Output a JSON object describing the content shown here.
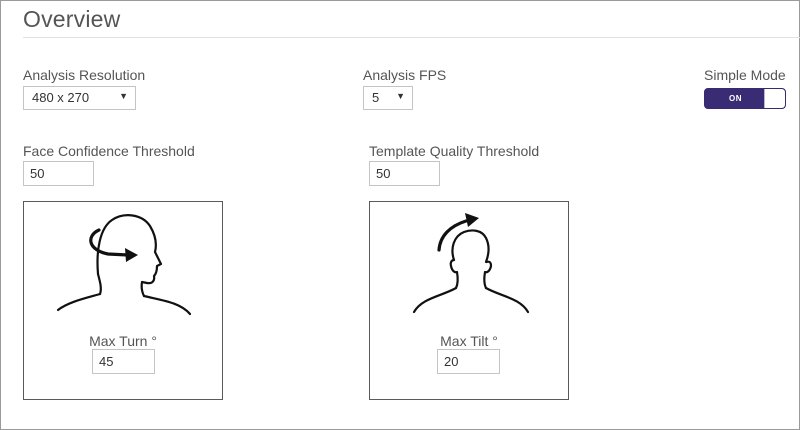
{
  "page": {
    "title": "Overview"
  },
  "analysis_resolution": {
    "label": "Analysis Resolution",
    "selected": "480 x 270",
    "caret_icon": "caret-down-icon"
  },
  "analysis_fps": {
    "label": "Analysis FPS",
    "selected": "5",
    "caret_icon": "caret-down-icon"
  },
  "simple_mode": {
    "label": "Simple Mode",
    "state_text": "ON",
    "on": true,
    "color": "#3a2c74"
  },
  "face_confidence": {
    "label": "Face Confidence Threshold",
    "value": "50"
  },
  "template_quality": {
    "label": "Template Quality Threshold",
    "value": "50"
  },
  "max_turn": {
    "icon": "head-turn-icon",
    "label": "Max Turn °",
    "value": "45"
  },
  "max_tilt": {
    "icon": "head-tilt-icon",
    "label": "Max Tilt °",
    "value": "20"
  }
}
